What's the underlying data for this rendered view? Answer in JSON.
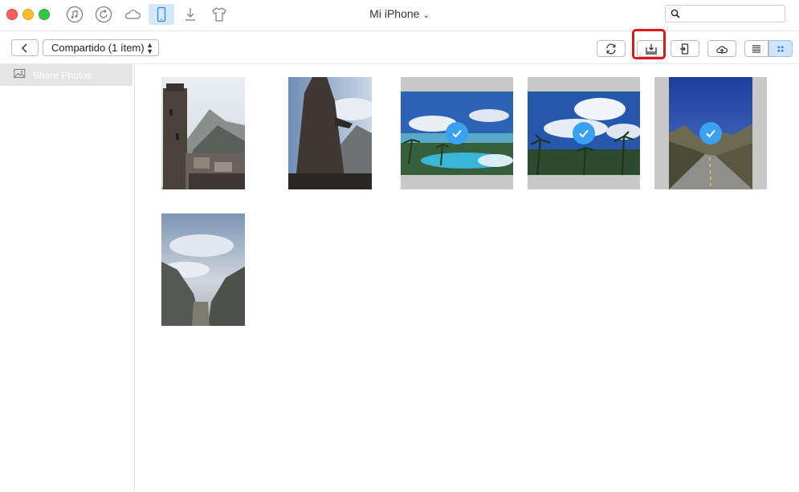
{
  "window": {
    "title": "Mi iPhone",
    "title_chevron": "⌄",
    "search_placeholder": ""
  },
  "titlebar_icons": [
    {
      "name": "music-icon"
    },
    {
      "name": "restore-icon"
    },
    {
      "name": "icloud-icon"
    },
    {
      "name": "iphone-icon",
      "active": true
    },
    {
      "name": "download-icon"
    },
    {
      "name": "tshirt-icon"
    }
  ],
  "toolbar": {
    "back_label": "",
    "category_select": "Compartido (1 ítem)",
    "updown": "⌃⌄",
    "buttons": [
      "refresh-icon",
      "to-computer-icon",
      "to-device-icon",
      "cloud-upload-icon",
      "list-view-icon",
      "grid-view-icon"
    ]
  },
  "sidebar": {
    "items": [
      {
        "label": "Share Photos",
        "selected": true
      }
    ]
  },
  "photos": [
    {
      "name": "tower-village",
      "selected": false
    },
    {
      "name": "stone-tower",
      "selected": false
    },
    {
      "name": "beach-pool",
      "selected": true
    },
    {
      "name": "palm-sky",
      "selected": true
    },
    {
      "name": "mountain-road",
      "selected": true
    },
    {
      "name": "misty-valley",
      "selected": false
    }
  ],
  "colors": {
    "accent": "#3aa0f0",
    "highlight": "#e0161e",
    "grid_active": "#cfe3fa"
  }
}
